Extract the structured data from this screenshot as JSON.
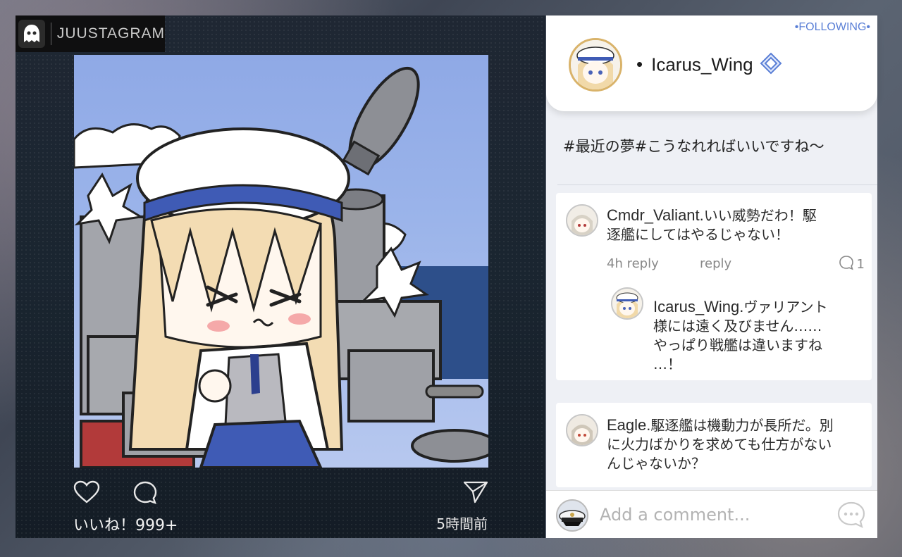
{
  "app": {
    "brand_name": "JUUSTAGRAM",
    "brand_icon": "ghost-logo-icon"
  },
  "post": {
    "likes_text": "いいね！999+",
    "time_text": "5時間前",
    "icons": [
      "heart-icon",
      "comment-icon",
      "send-icon"
    ]
  },
  "profile": {
    "following_label": "•FOLLOWING•",
    "username": "Icarus_Wing",
    "bullet": "•",
    "verified_icon": "verified-diamond-icon"
  },
  "caption": "#最近の夢#こうなれればいいですね～",
  "comments": [
    {
      "author": "Cmdr_Valiant.",
      "text": "いい威勢だわ！駆逐艦にしてはやるじゃない！",
      "line1": "いい威勢だわ！駆",
      "line2": "逐艦にしてはやるじゃない！",
      "time_reply": "4h reply",
      "reply_label": "reply",
      "reply_count": "1",
      "reply": {
        "author": "Icarus_Wing.",
        "line1": "ヴァリアント",
        "line2": "様には遠く及びません……",
        "line3": "やっぱり戦艦は違いますね",
        "line4": "…！"
      }
    },
    {
      "author": "Eagle.",
      "line1": "駆逐艦は機動力が長所だ。別",
      "line2": "に火力ばかりを求めても仕方がない",
      "line3": "んじゃないか？"
    }
  ],
  "comment_input": {
    "placeholder": "Add a comment..."
  },
  "colors": {
    "accent": "#5a7fd6",
    "panel_dark": "#1a2530",
    "panel_light": "#eef0f5"
  }
}
